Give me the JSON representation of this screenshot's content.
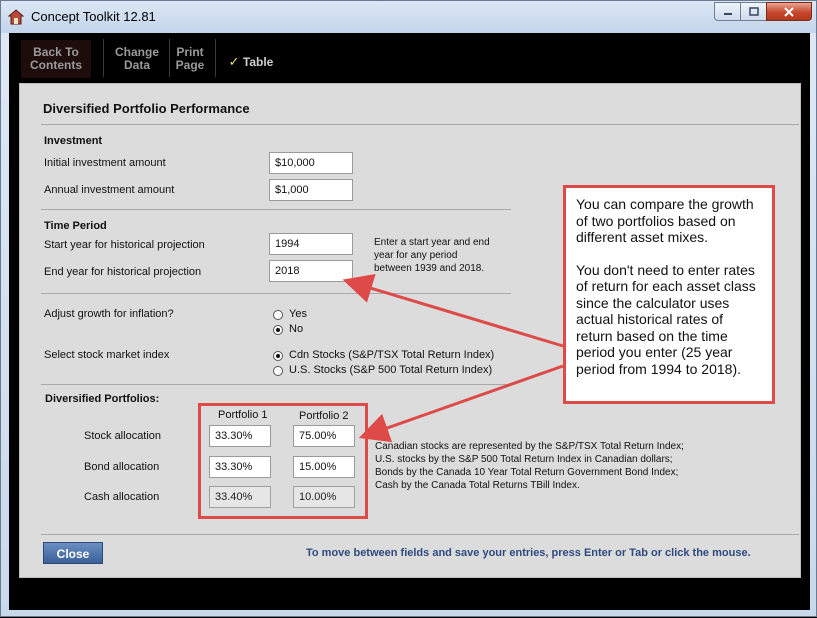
{
  "window": {
    "title": "Concept Toolkit 12.81"
  },
  "toolbar": {
    "back_line1": "Back To",
    "back_line2": "Contents",
    "change_line1": "Change",
    "change_line2": "Data",
    "print_line1": "Print",
    "print_line2": "Page",
    "table_check": "✓",
    "table_label": "Table"
  },
  "page": {
    "title": "Diversified Portfolio Performance"
  },
  "investment": {
    "heading": "Investment",
    "initial_label": "Initial investment amount",
    "initial_value": "$10,000",
    "annual_label": "Annual investment amount",
    "annual_value": "$1,000"
  },
  "time_period": {
    "heading": "Time Period",
    "start_label": "Start year for historical projection",
    "start_value": "1994",
    "end_label": "End year for historical projection",
    "end_value": "2018",
    "help_line1": "Enter a start year and end",
    "help_line2": "year for any period",
    "help_line3": "between 1939 and 2018."
  },
  "inflation": {
    "label": "Adjust growth for inflation?",
    "yes": "Yes",
    "no": "No",
    "selected": "No"
  },
  "index": {
    "label": "Select stock market index",
    "option1": "Cdn Stocks (S&P/TSX Total Return Index)",
    "option2": "U.S. Stocks (S&P 500 Total Return Index)",
    "selected": "option1"
  },
  "portfolios": {
    "heading": "Diversified Portfolios:",
    "col1": "Portfolio 1",
    "col2": "Portfolio 2",
    "stock_label": "Stock allocation",
    "stock_p1": "33.30%",
    "stock_p2": "75.00%",
    "bond_label": "Bond allocation",
    "bond_p1": "33.30%",
    "bond_p2": "15.00%",
    "cash_label": "Cash allocation",
    "cash_p1": "33.40%",
    "cash_p2": "10.00%",
    "note_line1": "Canadian stocks are represented by the S&P/TSX Total Return Index;",
    "note_line2": "U.S. stocks by the S&P 500 Total Return Index in Canadian dollars;",
    "note_line3": "Bonds by the Canada 10 Year Total Return Government Bond Index;",
    "note_line4": "Cash by the Canada Total Returns TBill Index."
  },
  "callout": {
    "para1": "You can compare the growth of two portfolios based on different asset mixes.",
    "para2": "You don't need to enter rates of return for each asset class since the calculator uses actual historical rates of return based on the time period you enter (25 year period from 1994 to 2018)."
  },
  "footer": {
    "close_label": "Close",
    "hint": "To move between fields and save your entries, press Enter or Tab or click the mouse."
  },
  "colors": {
    "accent_red": "#dd4a48",
    "button_blue": "#3b5f98",
    "hint_blue": "#2e4a80"
  }
}
